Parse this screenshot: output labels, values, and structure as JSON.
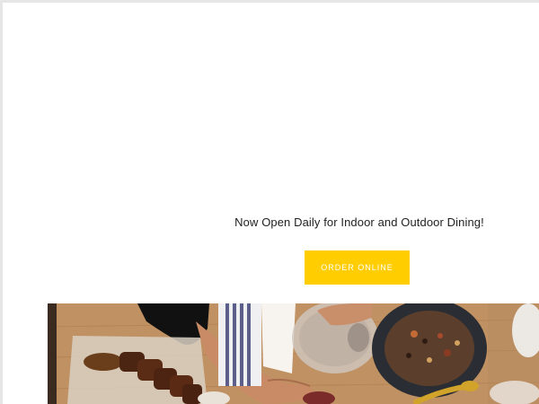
{
  "hero": {
    "announcement": "Now Open Daily for Indoor and Outdoor Dining!",
    "order_button": "ORDER ONLINE"
  },
  "colors": {
    "accent": "#ffcd00",
    "page_background": "#ffffff",
    "frame": "#e6e6e6",
    "text": "#1f1f1f"
  }
}
